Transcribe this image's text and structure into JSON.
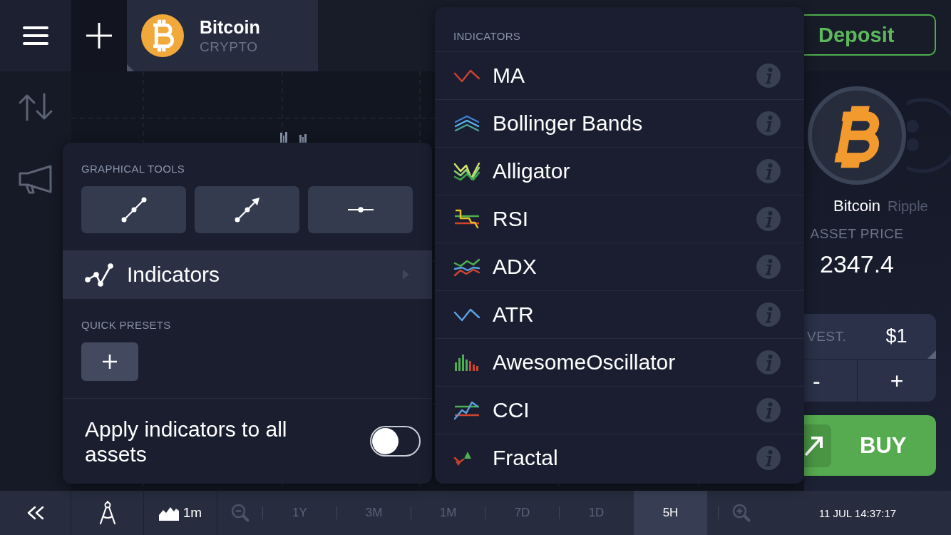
{
  "top_bar": {
    "asset_tab": {
      "name": "Bitcoin",
      "category": "CRYPTO"
    },
    "deposit_button": "Deposit"
  },
  "tools_panel": {
    "graphical_tools_title": "GRAPHICAL TOOLS",
    "indicators_item": {
      "label": "Indicators",
      "selected": true
    },
    "quick_presets_title": "QUICK PRESETS",
    "apply_to_all": {
      "label": "Apply indicators to all assets",
      "on": false
    }
  },
  "indicators_panel": {
    "title": "INDICATORS",
    "items": [
      {
        "label": "MA"
      },
      {
        "label": "Bollinger Bands"
      },
      {
        "label": "Alligator"
      },
      {
        "label": "RSI"
      },
      {
        "label": "ADX"
      },
      {
        "label": "ATR"
      },
      {
        "label": "AwesomeOscillator"
      },
      {
        "label": "CCI"
      },
      {
        "label": "Fractal"
      }
    ]
  },
  "asset_panel": {
    "coins": [
      {
        "name": "Bitcoin",
        "selected": true
      },
      {
        "name": "Ripple",
        "selected": false
      }
    ],
    "price_label": "ASSET PRICE",
    "price": "2347.4",
    "invest": {
      "label": "VEST.",
      "value": "$1",
      "decrease": "-",
      "increase": "+"
    },
    "buy_button": "BUY"
  },
  "bottom_bar": {
    "chart_interval": "1m",
    "timeframes": [
      {
        "label": "1Y",
        "selected": false
      },
      {
        "label": "3M",
        "selected": false
      },
      {
        "label": "1M",
        "selected": false
      },
      {
        "label": "7D",
        "selected": false
      },
      {
        "label": "1D",
        "selected": false
      },
      {
        "label": "5H",
        "selected": true
      }
    ],
    "datetime": "11 JUL 14:37:17"
  }
}
